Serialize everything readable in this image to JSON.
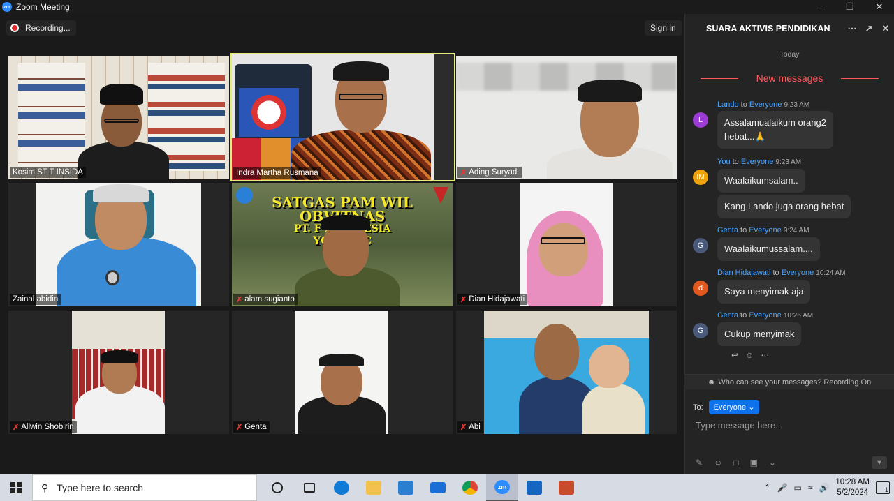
{
  "window": {
    "app_icon": "zm",
    "title": "Zoom Meeting",
    "controls": [
      "minimize-icon",
      "restore-icon",
      "close-icon"
    ]
  },
  "toolbar": {
    "recording_label": "Recording...",
    "signin_label": "Sign in"
  },
  "participants": [
    {
      "name": "Kosim ST T  INSIDA",
      "muted": false
    },
    {
      "name": "Indra Martha Rusmana",
      "muted": false,
      "active_speaker": true
    },
    {
      "name": "Ading Suryadi",
      "muted": true
    },
    {
      "name": "Zainal abidin",
      "muted": false
    },
    {
      "name": "alam sugianto",
      "muted": true
    },
    {
      "name": "Dian Hidajawati",
      "muted": true
    },
    {
      "name": "Allwin Shobirin",
      "muted": true
    },
    {
      "name": "Genta",
      "muted": true
    },
    {
      "name": "Abi",
      "muted": true
    }
  ],
  "banner_text": {
    "line1": "SATGAS PAM WIL OBVITNAS",
    "line2": "PT. F      INDONESIA",
    "line3": "YO       // ATC"
  },
  "chat": {
    "title": "SUARA AKTIVIS PENDIDIKAN",
    "day_label": "Today",
    "new_messages_label": "New messages",
    "messages": [
      {
        "avatar": "L",
        "avatar_color": "#9c3bd6",
        "sender": "Lando",
        "to_word": "to",
        "recipient": "Everyone",
        "time": "9:23 AM",
        "lines": [
          "Assalamualaikum orang2",
          "hebat...🙏"
        ]
      },
      {
        "avatar": "IM",
        "avatar_color": "#f0a30a",
        "sender": "You",
        "to_word": "to",
        "recipient": "Everyone",
        "time": "9:23 AM",
        "lines": [
          "Waalaikumsalam.."
        ]
      },
      {
        "lines": [
          "Kang Lando juga orang hebat"
        ]
      },
      {
        "avatar": "G",
        "avatar_color": "#4a5a7a",
        "sender": "Genta",
        "to_word": "to",
        "recipient": "Everyone",
        "time": "9:24 AM",
        "lines": [
          "Waalaikumussalam...."
        ]
      },
      {
        "avatar": "d",
        "avatar_color": "#e0581d",
        "sender": "Dian Hidajawati",
        "to_word": "to",
        "recipient": "Everyone",
        "time": "10:24 AM",
        "lines": [
          "Saya menyimak aja"
        ]
      },
      {
        "avatar": "G",
        "avatar_color": "#4a5a7a",
        "sender": "Genta",
        "to_word": "to",
        "recipient": "Everyone",
        "time": "10:26 AM",
        "lines": [
          "Cukup menyimak"
        ]
      }
    ],
    "visibility_note": "Who can see your messages? Recording On",
    "to_label": "To:",
    "recipient_button": "Everyone",
    "input_placeholder": "Type message here..."
  },
  "taskbar": {
    "search_placeholder": "Type here to search",
    "zoom_icon_label": "zm",
    "time": "10:28 AM",
    "date": "5/2/2024",
    "notification_count": "1"
  }
}
